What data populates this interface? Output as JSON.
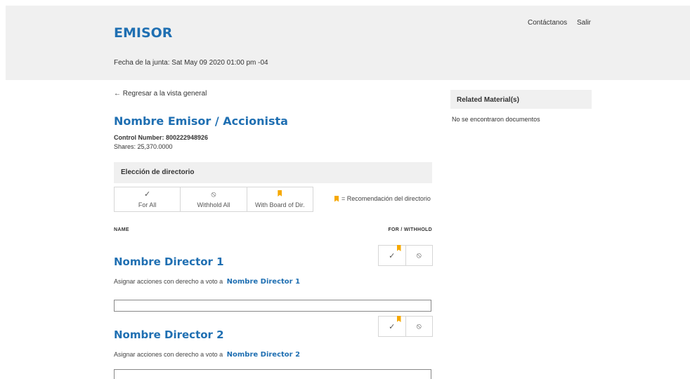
{
  "header": {
    "issuer": "EMISOR",
    "meeting_date": "Fecha de la junta: Sat May 09 2020 01:00 pm -04",
    "nav": {
      "contact": "Contáctanos",
      "logout": "Salir"
    }
  },
  "main": {
    "back_link": "← Regresar a la vista general",
    "holder_name": "Nombre Emisor / Accionista",
    "control_number": "Control Number: 800222948926",
    "shares": "Shares: 25,370.0000",
    "section_title": "Elección de directorio",
    "bulk_actions": [
      {
        "icon": "✓",
        "label": "For All"
      },
      {
        "icon": "⦸",
        "label": "Withhold All"
      },
      {
        "icon": "bookmark-flag",
        "label": "With Board of Dir."
      }
    ],
    "legend": "= Recomendación del directorio",
    "columns": {
      "name": "NAME",
      "for_withhold": "FOR / WITHHOLD"
    },
    "vote_icons": {
      "for": "✓",
      "withhold": "⦸"
    },
    "directors": [
      {
        "name": "Nombre Director 1",
        "assign_prefix": "Asignar acciones con derecho a voto a",
        "assign_name": "Nombre Director 1",
        "input_value": ""
      },
      {
        "name": "Nombre Director 2",
        "assign_prefix": "Asignar acciones con derecho a voto a",
        "assign_name": "Nombre Director 2",
        "input_value": ""
      }
    ]
  },
  "sidebar": {
    "title": "Related Material(s)",
    "empty_text": "No se encontraron documentos"
  },
  "colors": {
    "accent": "#1f6fb2",
    "recommend_flag": "#f6a800",
    "panel_bg": "#f0f0f0"
  }
}
